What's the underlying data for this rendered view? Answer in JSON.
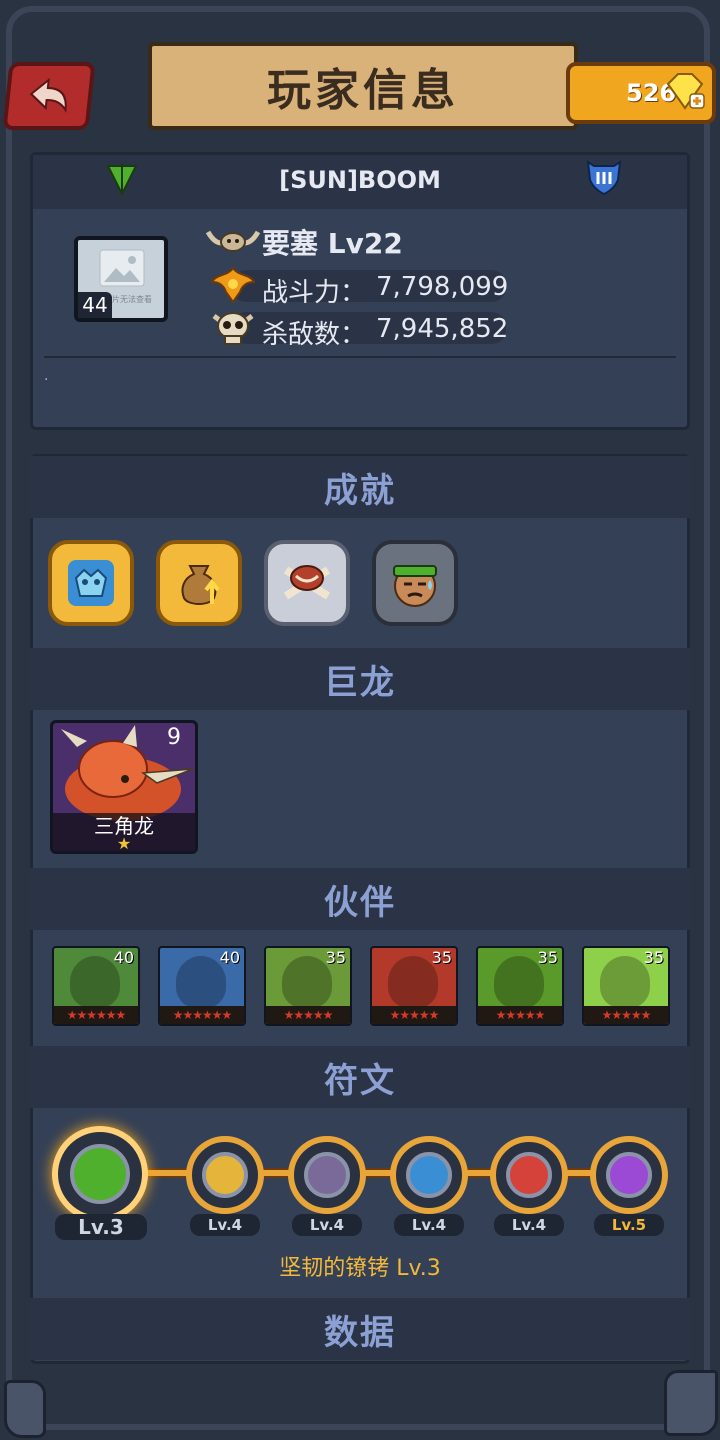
{
  "header": {
    "title": "玩家信息",
    "gems": "526"
  },
  "player": {
    "name": "[SUN]BOOM",
    "avatar_level": "44",
    "avatar_placeholder": "图片无法查看",
    "fortress": "要塞 Lv22",
    "power_label": "战斗力：",
    "power_value": "7,798,099",
    "kills_label": "杀敌数：",
    "kills_value": "7,945,852",
    "signature": "."
  },
  "sections": {
    "achievements": "成就",
    "dragons": "巨龙",
    "partners": "伙伴",
    "runes": "符文",
    "data": "数据"
  },
  "achievements": [
    {
      "icon": "blue-monster-badge",
      "color": "#f2b93a"
    },
    {
      "icon": "money-bag-badge",
      "color": "#f2b93a"
    },
    {
      "icon": "meat-bone-badge",
      "color": "#c9ced9"
    },
    {
      "icon": "sweating-soldier-badge",
      "color": "#6a717f"
    }
  ],
  "dragon": {
    "name": "三角龙",
    "count": "9",
    "stars": "★"
  },
  "partners": [
    {
      "level": "40",
      "stars": "★★★★★★",
      "color": "#4f8a3a",
      "icon": "green-hero-portrait"
    },
    {
      "level": "40",
      "stars": "★★★★★★",
      "color": "#3a6aa8",
      "icon": "bearded-warrior-portrait"
    },
    {
      "level": "35",
      "stars": "★★★★★",
      "color": "#6b9a38",
      "icon": "witch-hat-portrait"
    },
    {
      "level": "35",
      "stars": "★★★★★",
      "color": "#b33a2a",
      "icon": "red-hood-portrait"
    },
    {
      "level": "35",
      "stars": "★★★★★",
      "color": "#5a9a2a",
      "icon": "crocodile-portrait"
    },
    {
      "level": "35",
      "stars": "★★★★★",
      "color": "#8fd04a",
      "icon": "dragon-pet-portrait"
    }
  ],
  "runes": [
    {
      "level": "Lv.3",
      "color": "#4fb02e"
    },
    {
      "level": "Lv.4",
      "color": "#e5b43a"
    },
    {
      "level": "Lv.4",
      "color": "#7a6a9a"
    },
    {
      "level": "Lv.4",
      "color": "#3a8fd4"
    },
    {
      "level": "Lv.4",
      "color": "#d4423a"
    },
    {
      "level": "Lv.5",
      "color": "#9a4ad4"
    }
  ],
  "selected_rune": "坚韧的镣铐 Lv.3"
}
